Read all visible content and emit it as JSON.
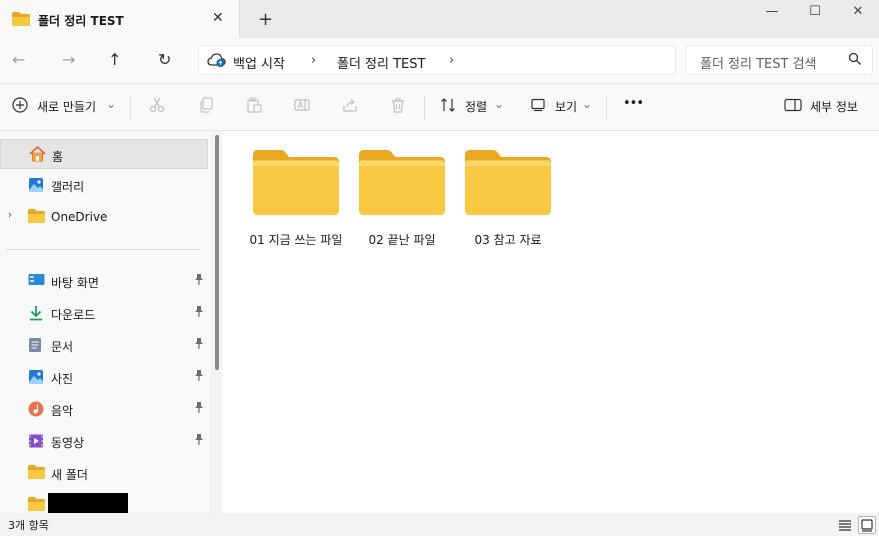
{
  "tab": {
    "title": "폴더 정리 TEST",
    "close": "✕",
    "new": "+"
  },
  "window": {
    "minimize": "—",
    "maximize": "☐",
    "close": "✕"
  },
  "nav": {
    "back": "←",
    "forward": "→",
    "up": "↑",
    "refresh": "↻"
  },
  "breadcrumb": {
    "items": [
      "백업 시작",
      "폴더 정리 TEST"
    ],
    "separator": "›"
  },
  "search": {
    "placeholder": "폴더 정리 TEST 검색"
  },
  "toolbar": {
    "new": "새로 만들기",
    "sort": "정렬",
    "view": "보기",
    "more": "•••",
    "details": "세부 정보",
    "dropdown": "⌄"
  },
  "sidebar": {
    "top": [
      {
        "label": "홈",
        "icon": "home-icon",
        "selected": true
      },
      {
        "label": "갤러리",
        "icon": "gallery-icon"
      },
      {
        "label": "OneDrive",
        "icon": "folder-icon"
      }
    ],
    "pinned": [
      {
        "label": "바탕 화면",
        "icon": "desktop-icon"
      },
      {
        "label": "다운로드",
        "icon": "download-icon"
      },
      {
        "label": "문서",
        "icon": "document-icon"
      },
      {
        "label": "사진",
        "icon": "pictures-icon"
      },
      {
        "label": "음악",
        "icon": "music-icon"
      },
      {
        "label": "동영상",
        "icon": "videos-icon"
      }
    ],
    "folders": [
      {
        "label": "새 폴더",
        "icon": "folder-icon"
      }
    ],
    "expander": "›",
    "pin": "📌"
  },
  "files": [
    {
      "name": "01 지금 쓰는 파일"
    },
    {
      "name": "02 끝난 파일"
    },
    {
      "name": "03 참고 자료"
    }
  ],
  "status": {
    "count": "3개 항목"
  },
  "colors": {
    "folder": "#f8c840",
    "folder_dark": "#e8a824",
    "accent": "#0067c0"
  }
}
